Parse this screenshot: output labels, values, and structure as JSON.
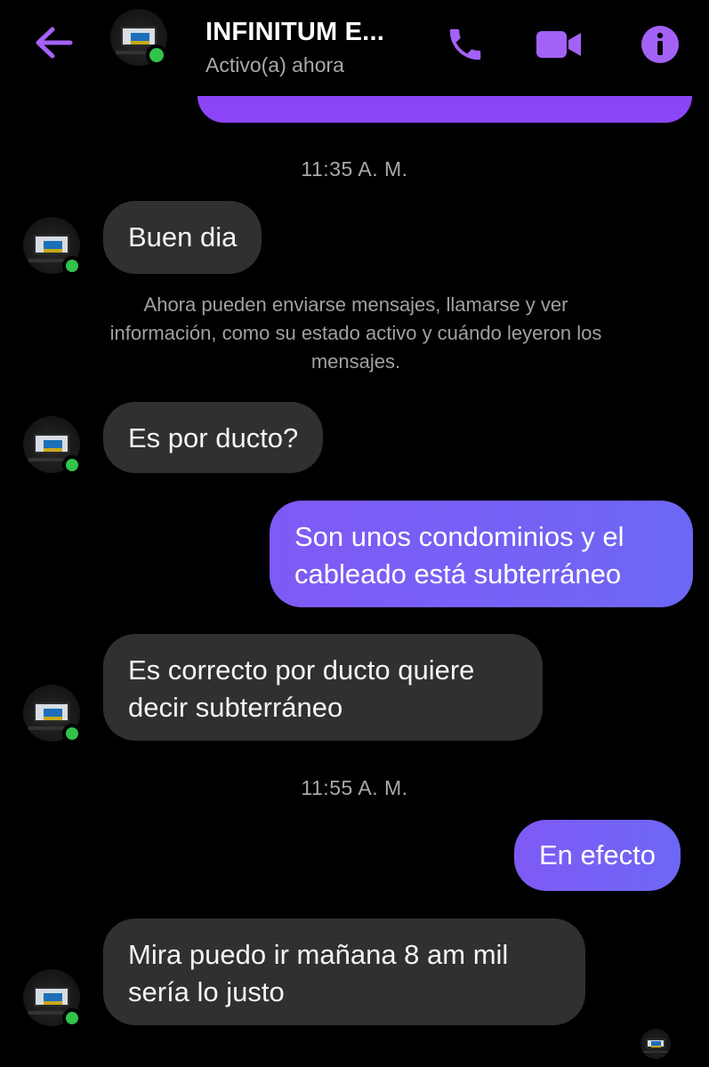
{
  "header": {
    "back_icon": "arrow-left-icon",
    "contact_name": "INFINITUM E...",
    "status": "Activo(a) ahora",
    "call_icon": "phone-icon",
    "video_icon": "video-camera-icon",
    "info_icon": "info-icon",
    "accent_color": "#a461f5",
    "online_color": "#31c34a"
  },
  "chat": {
    "timestamp_1": "11:35 A. M.",
    "msg_1": "Buen dia",
    "notice": "Ahora pueden enviarse mensajes, llamarse y ver información, como su estado activo y cuándo leyeron los mensajes.",
    "msg_2": "Es por ducto?",
    "msg_3_line1": "Son unos condominios y el",
    "msg_3_line2": "cableado está subterráneo",
    "msg_4_line1": "Es correcto por ducto quiere",
    "msg_4_line2": "decir subterráneo",
    "timestamp_2": "11:55 A. M.",
    "msg_5": "En efecto",
    "msg_6_line1": "Mira puedo ir mañana 8 am mil",
    "msg_6_line2": "sería lo justo",
    "incoming_bubble_color": "#303030",
    "outgoing_bubble_color": "#7b5cf6"
  }
}
